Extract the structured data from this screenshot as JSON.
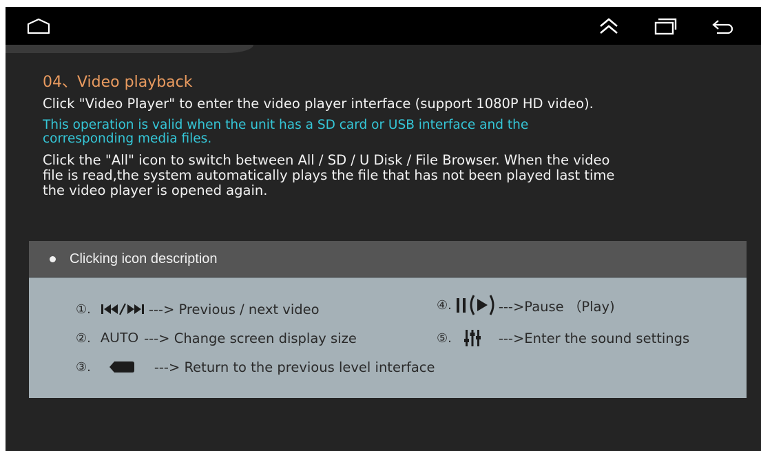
{
  "nav": {
    "home_icon": "home-icon",
    "collapse_icon": "double-chevron-up-icon",
    "recent_icon": "recent-apps-icon",
    "back_icon": "back-icon"
  },
  "content": {
    "title": "04、Video playback",
    "para1": "Click \"Video Player\" to enter the video player interface (support 1080P HD video).",
    "notice_line1": "This operation is valid when the unit has a SD card or USB interface and the",
    "notice_line2": "corresponding media files.",
    "para2_line1": "Click the \"All\" icon to switch between All / SD / U Disk / File Browser. When the video",
    "para2_line2": "file is read,the system automatically plays the file that has not been played last time",
    "para2_line3": "the video player is opened again."
  },
  "description": {
    "header": "Clicking icon description",
    "items": [
      {
        "num": "①.",
        "icon": "prev-next-icon",
        "text": "---> Previous / next video"
      },
      {
        "num": "②.",
        "label": "AUTO",
        "text": "---> Change screen display size"
      },
      {
        "num": "③.",
        "icon": "back-pill-icon",
        "text": "---> Return to the previous level interface"
      },
      {
        "num": "④.",
        "icon": "pause-play-icon",
        "text": "--->Pause （Play)"
      },
      {
        "num": "⑤.",
        "icon": "equalizer-icon",
        "text": "--->Enter the sound settings"
      }
    ]
  },
  "colors": {
    "title": "#e89a5f",
    "notice": "#35c7d8",
    "body_text": "#f2f2f2",
    "panel": "#a5b1b7",
    "header_bar": "#555555",
    "background": "#242424"
  }
}
